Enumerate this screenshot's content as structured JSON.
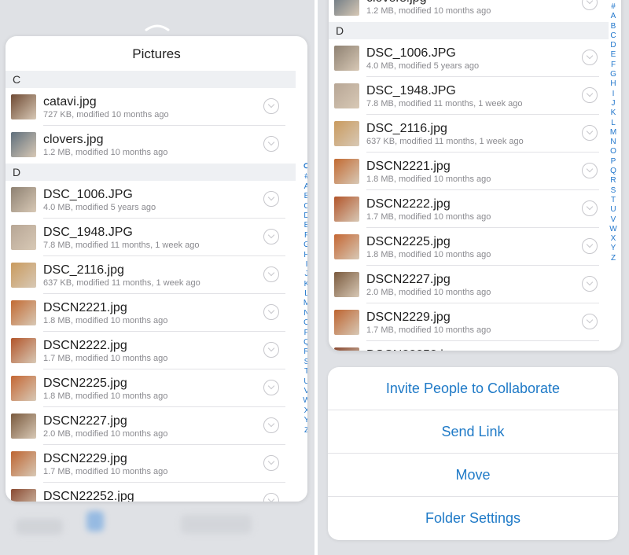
{
  "title": "Pictures",
  "sections": [
    {
      "letter": "C",
      "items": [
        {
          "name": "catavi.jpg",
          "meta": "727 KB, modified 10 months ago",
          "thumb_color": "#6f4a34"
        },
        {
          "name": "clovers.jpg",
          "meta": "1.2 MB, modified 10 months ago",
          "thumb_color": "#5f6f7c"
        }
      ]
    },
    {
      "letter": "D",
      "items": [
        {
          "name": "DSC_1006.JPG",
          "meta": "4.0 MB, modified 5 years ago",
          "thumb_color": "#8e8172"
        },
        {
          "name": "DSC_1948.JPG",
          "meta": "7.8 MB, modified 11 months, 1 week ago",
          "thumb_color": "#b7a695"
        },
        {
          "name": "DSC_2116.jpg",
          "meta": "637 KB, modified 11 months, 1 week ago",
          "thumb_color": "#c99a5e"
        },
        {
          "name": "DSCN2221.jpg",
          "meta": "1.8 MB, modified 10 months ago",
          "thumb_color": "#c26a32"
        },
        {
          "name": "DSCN2222.jpg",
          "meta": "1.7 MB, modified 10 months ago",
          "thumb_color": "#b2552a"
        },
        {
          "name": "DSCN2225.jpg",
          "meta": "1.8 MB, modified 10 months ago",
          "thumb_color": "#c46734"
        },
        {
          "name": "DSCN2227.jpg",
          "meta": "2.0 MB, modified 10 months ago",
          "thumb_color": "#7a5a3e"
        },
        {
          "name": "DSCN2229.jpg",
          "meta": "1.7 MB, modified 10 months ago",
          "thumb_color": "#bd6430"
        },
        {
          "name": "DSCN22252.jpg",
          "meta": "",
          "thumb_color": "#8a4a32"
        }
      ]
    }
  ],
  "left_index": [
    "Q-icon",
    "#",
    "A",
    "B",
    "C",
    "D",
    "E",
    "F",
    "G",
    "H",
    "I",
    "J",
    "K",
    "L",
    "M",
    "N",
    "O",
    "P",
    "Q",
    "R",
    "S",
    "T",
    "U",
    "V",
    "W",
    "X",
    "Y",
    "Z"
  ],
  "right_index": [
    "#",
    "A",
    "B",
    "C",
    "D",
    "E",
    "F",
    "G",
    "H",
    "I",
    "J",
    "K",
    "L",
    "M",
    "N",
    "O",
    "P",
    "Q",
    "R",
    "S",
    "T",
    "U",
    "V",
    "W",
    "X",
    "Y",
    "Z"
  ],
  "actions": [
    "Invite People to Collaborate",
    "Send Link",
    "Move",
    "Folder Settings"
  ],
  "colors": {
    "accent": "#1f7ac7",
    "index": "#2277cc",
    "background": "#dfe1e5"
  }
}
